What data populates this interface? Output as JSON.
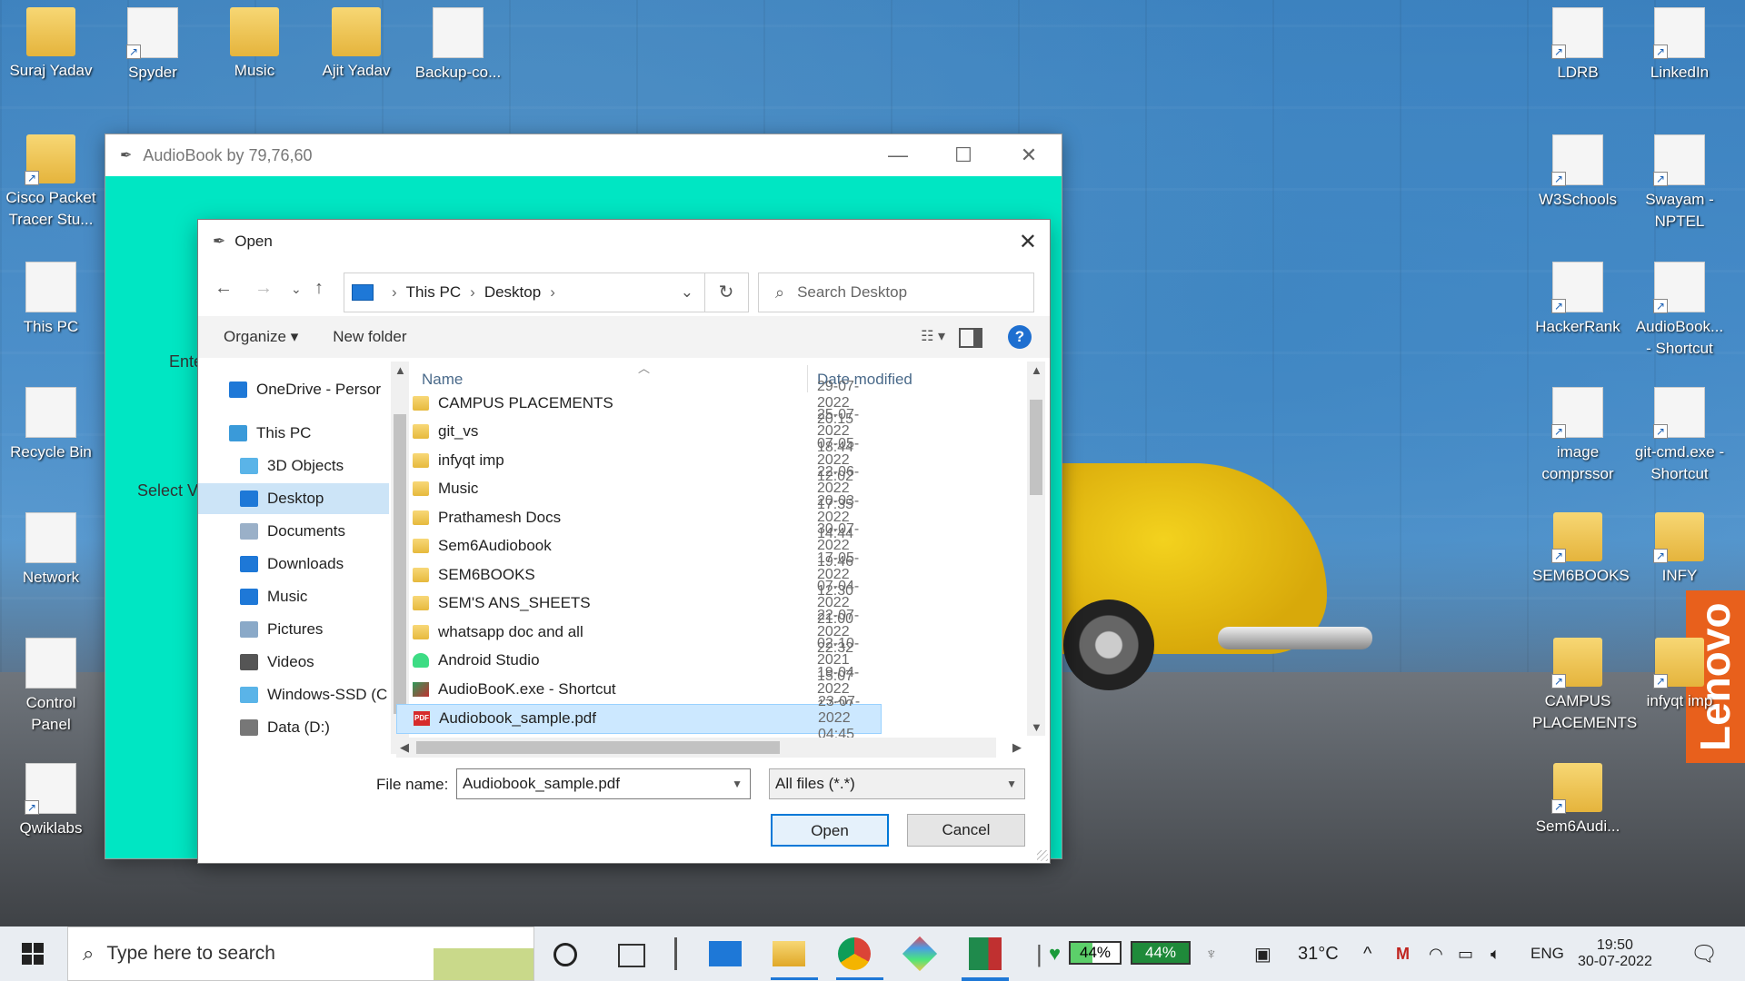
{
  "desktop": {
    "icons_left": [
      {
        "label": "Suraj Yadav",
        "col": 0,
        "row": 0
      },
      {
        "label": "Spyder",
        "col": 1,
        "row": 0
      },
      {
        "label": "Music",
        "col": 2,
        "row": 0
      },
      {
        "label": "Ajit Yadav",
        "col": 3,
        "row": 0
      },
      {
        "label": "Backup-co...",
        "col": 4,
        "row": 0
      },
      {
        "label": "Cisco Packet Tracer Stu...",
        "col": 0,
        "row": 1
      },
      {
        "label": "This PC",
        "col": 0,
        "row": 2
      },
      {
        "label": "Recycle Bin",
        "col": 0,
        "row": 3
      },
      {
        "label": "Network",
        "col": 0,
        "row": 4
      },
      {
        "label": "Control Panel",
        "col": 0,
        "row": 5
      },
      {
        "label": "Qwiklabs",
        "col": 0,
        "row": 6
      }
    ],
    "icons_right": [
      {
        "label": "LDRB"
      },
      {
        "label": "LinkedIn"
      },
      {
        "label": "W3Schools"
      },
      {
        "label": "Swayam - NPTEL"
      },
      {
        "label": "HackerRank"
      },
      {
        "label": "AudioBook... - Shortcut"
      },
      {
        "label": "image comprssor"
      },
      {
        "label": "git-cmd.exe - Shortcut"
      },
      {
        "label": "SEM6BOOKS"
      },
      {
        "label": "INFY"
      },
      {
        "label": "CAMPUS PLACEMENTS"
      },
      {
        "label": "infyqt imp"
      },
      {
        "label": "Sem6Audi..."
      }
    ],
    "brand_badge": "Lenovo"
  },
  "app_window": {
    "title": "AudioBook by 79,76,60",
    "bg_color": "#00e6c3",
    "label_enter": "Ente",
    "label_select": "Select Vo",
    "controls": {
      "minimize": "—",
      "maximize": "☐",
      "close": "✕"
    }
  },
  "open_dialog": {
    "title": "Open",
    "close": "✕",
    "nav": {
      "back": "←",
      "forward": "→",
      "recent": "⌄",
      "up": "↑"
    },
    "address": {
      "segments": [
        "This PC",
        "Desktop"
      ],
      "separator": "›"
    },
    "refresh": "↻",
    "search_placeholder": "Search Desktop",
    "toolbar": {
      "organize": "Organize ▾",
      "new_folder": "New folder",
      "help": "?"
    },
    "nav_pane": [
      {
        "label": "OneDrive - Persor",
        "icon": "cloud-icon",
        "color": "#1e78d7",
        "indent": 0
      },
      {
        "label": "This PC",
        "icon": "computer-icon",
        "color": "#3a9ad9",
        "indent": 0
      },
      {
        "label": "3D Objects",
        "icon": "cube-icon",
        "color": "#5ab4e8",
        "indent": 1
      },
      {
        "label": "Desktop",
        "icon": "desktop-icon",
        "color": "#1e78d7",
        "indent": 1,
        "selected": true
      },
      {
        "label": "Documents",
        "icon": "document-icon",
        "color": "#9ab0c8",
        "indent": 1
      },
      {
        "label": "Downloads",
        "icon": "download-icon",
        "color": "#1e78d7",
        "indent": 1
      },
      {
        "label": "Music",
        "icon": "music-icon",
        "color": "#1e78d7",
        "indent": 1
      },
      {
        "label": "Pictures",
        "icon": "picture-icon",
        "color": "#8aa9c8",
        "indent": 1
      },
      {
        "label": "Videos",
        "icon": "video-icon",
        "color": "#555555",
        "indent": 1
      },
      {
        "label": "Windows-SSD (C",
        "icon": "drive-icon",
        "color": "#5ab4e8",
        "indent": 1
      },
      {
        "label": "Data (D:)",
        "icon": "drive-icon",
        "color": "#777777",
        "indent": 1
      }
    ],
    "columns": {
      "name": "Name",
      "date": "Date modified"
    },
    "files": [
      {
        "name": "CAMPUS PLACEMENTS",
        "date": "29-07-2022 20:15",
        "type": "folder"
      },
      {
        "name": "git_vs",
        "date": "25-07-2022 18:44",
        "type": "folder"
      },
      {
        "name": "infyqt imp",
        "date": "07-05-2022 12:02",
        "type": "folder"
      },
      {
        "name": "Music",
        "date": "22-06-2022 17:35",
        "type": "folder"
      },
      {
        "name": "Prathamesh Docs",
        "date": "20-03-2022 14:44",
        "type": "folder"
      },
      {
        "name": "Sem6Audiobook",
        "date": "30-07-2022 19:46",
        "type": "folder"
      },
      {
        "name": "SEM6BOOKS",
        "date": "17-05-2022 12:30",
        "type": "folder"
      },
      {
        "name": "SEM'S ANS_SHEETS",
        "date": "07-04-2022 21:00",
        "type": "folder"
      },
      {
        "name": "whatsapp doc and all",
        "date": "22-07-2022 22:32",
        "type": "folder"
      },
      {
        "name": "Android Studio",
        "date": "02-10-2021 15:07",
        "type": "android"
      },
      {
        "name": "AudioBooK.exe - Shortcut",
        "date": "19-04-2022 17:20",
        "type": "exe"
      },
      {
        "name": "Audiobook_sample.pdf",
        "date": "23-07-2022 04:45",
        "type": "pdf",
        "selected": true
      }
    ],
    "file_name_label": "File name:",
    "file_name_value": "Audiobook_sample.pdf",
    "file_type_value": "All files (*.*)",
    "open_label": "Open",
    "cancel_label": "Cancel"
  },
  "taskbar": {
    "search_placeholder": "Type here to search",
    "battery1": "44%",
    "battery2": "44%",
    "weather": "31°C",
    "language": "ENG",
    "time": "19:50",
    "date": "30-07-2022"
  }
}
